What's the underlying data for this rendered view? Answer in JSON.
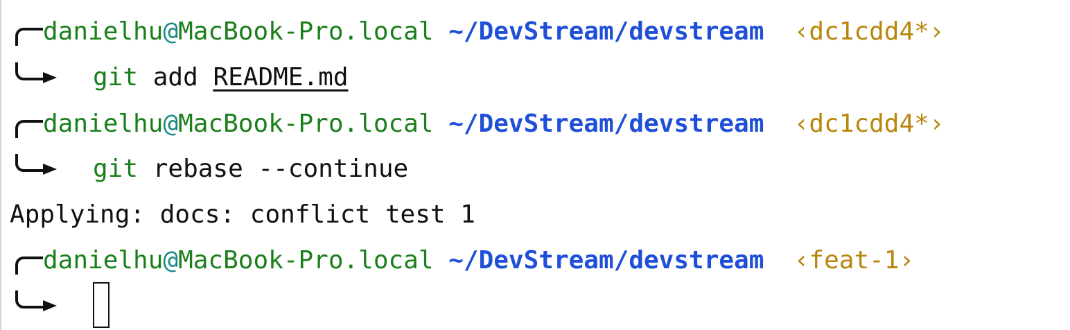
{
  "prompt": {
    "user": "danielhu",
    "at": "@",
    "host": "MacBook-Pro.local",
    "path": "~/DevStream/devstream"
  },
  "entries": [
    {
      "branch": "‹dc1cdd4*›",
      "command": "git",
      "args": "add",
      "file": "README.md"
    },
    {
      "branch": "‹dc1cdd4*›",
      "command": "git",
      "args": "rebase --continue"
    },
    {
      "output": "Applying: docs: conflict test 1"
    },
    {
      "branch": "‹feat-1›"
    }
  ],
  "colors": {
    "user": "#1a7f1a",
    "at": "#1b8a86",
    "path": "#1f4fd8",
    "branch": "#b8860b",
    "text": "#111111"
  }
}
